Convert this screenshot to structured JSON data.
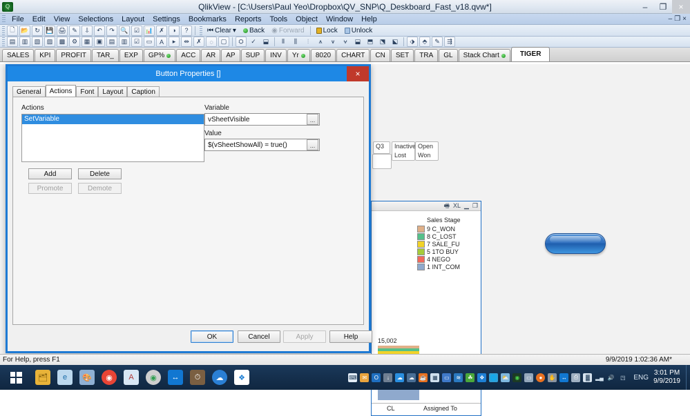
{
  "window": {
    "title": "QlikView - [C:\\Users\\Paul Yeo\\Dropbox\\QV_SNP\\Q_Deskboard_Fast_v18.qvw*]",
    "app_icon": "qlikview-icon",
    "minimize": "–",
    "restore": "❐",
    "close": "×"
  },
  "menubar": {
    "items": [
      {
        "label": "File"
      },
      {
        "label": "Edit"
      },
      {
        "label": "View"
      },
      {
        "label": "Selections"
      },
      {
        "label": "Layout"
      },
      {
        "label": "Settings"
      },
      {
        "label": "Bookmarks"
      },
      {
        "label": "Reports"
      },
      {
        "label": "Tools"
      },
      {
        "label": "Object"
      },
      {
        "label": "Window"
      },
      {
        "label": "Help"
      }
    ],
    "doc_controls": [
      "–",
      "❐",
      "×"
    ]
  },
  "toolbar": {
    "clear": "Clear",
    "clear_caret": "▾",
    "back": "Back",
    "forward": "Forward",
    "lock": "Lock",
    "unlock": "Unlock"
  },
  "sheet_tabs": [
    {
      "label": "SALES",
      "dot": false,
      "active": false
    },
    {
      "label": "KPI",
      "dot": false,
      "active": false
    },
    {
      "label": "PROFIT",
      "dot": false,
      "active": false
    },
    {
      "label": "TAR_",
      "dot": false,
      "active": false
    },
    {
      "label": "EXP",
      "dot": false,
      "active": false
    },
    {
      "label": "GP%",
      "dot": true,
      "active": false
    },
    {
      "label": "ACC",
      "dot": false,
      "active": false
    },
    {
      "label": "AR",
      "dot": false,
      "active": false
    },
    {
      "label": "AP",
      "dot": false,
      "active": false
    },
    {
      "label": "SUP",
      "dot": false,
      "active": false
    },
    {
      "label": "INV",
      "dot": false,
      "active": false
    },
    {
      "label": "Yr",
      "dot": true,
      "active": false
    },
    {
      "label": "8020",
      "dot": false,
      "active": false
    },
    {
      "label": "CHART",
      "dot": false,
      "active": false
    },
    {
      "label": "CN",
      "dot": false,
      "active": false
    },
    {
      "label": "SET",
      "dot": false,
      "active": false
    },
    {
      "label": "TRA",
      "dot": false,
      "active": false
    },
    {
      "label": "GL",
      "dot": false,
      "active": false
    },
    {
      "label": "Stack Chart",
      "dot": true,
      "active": false
    },
    {
      "label": "TIGER",
      "dot": false,
      "active": true
    }
  ],
  "dialog": {
    "title": "Button Properties []",
    "close": "×",
    "tabs": [
      {
        "label": "General",
        "active": false
      },
      {
        "label": "Actions",
        "active": true
      },
      {
        "label": "Font",
        "active": false
      },
      {
        "label": "Layout",
        "active": false
      },
      {
        "label": "Caption",
        "active": false
      }
    ],
    "actions_label": "Actions",
    "actions_items": [
      "SetVariable"
    ],
    "variable_label": "Variable",
    "variable_value": "vSheetVisible",
    "value_label": "Value",
    "value_value": "$(vSheetShowAll) = true()",
    "ellipsis": "...",
    "buttons": {
      "add": "Add",
      "delete": "Delete",
      "promote": "Promote",
      "demote": "Demote"
    },
    "footer": {
      "ok": "OK",
      "cancel": "Cancel",
      "apply": "Apply",
      "help": "Help"
    }
  },
  "listboxes": [
    {
      "name": "q3",
      "cells": [
        "Q3"
      ]
    },
    {
      "name": "status",
      "cells": [
        "Inactive",
        "Lost"
      ]
    },
    {
      "name": "outcome",
      "cells": [
        "Open",
        "Won"
      ]
    }
  ],
  "chart_panel": {
    "caption_icons": [
      "print-icon",
      "XL",
      "–",
      "❐"
    ],
    "xl_label": "XL"
  },
  "chart_data": {
    "type": "bar",
    "title": "",
    "legend_title": "Sales Stage",
    "legend_position": "top-right",
    "stacked": true,
    "categories": [
      "CL"
    ],
    "xlabel": "Assigned To",
    "ylabel": "",
    "total_label": "15,002",
    "total_value": 15002,
    "series": [
      {
        "name": "9 C_WON",
        "color": "#e0b088",
        "values": [
          500
        ]
      },
      {
        "name": "8 C_LOST",
        "color": "#55c08a",
        "values": [
          420
        ]
      },
      {
        "name": "7 SALE_FU",
        "color": "#f2d329",
        "values": [
          1150
        ]
      },
      {
        "name": "5 1TO BUY",
        "color": "#a6cc3a",
        "values": [
          480
        ]
      },
      {
        "name": "4 NEGO",
        "color": "#f2695c",
        "values": [
          900
        ]
      },
      {
        "name": "1 INT_COM",
        "color": "#8fa9cd",
        "values": [
          11552
        ]
      }
    ]
  },
  "statusbar": {
    "help_text": "For Help, press F1",
    "timestamp": "9/9/2019 1:02:36 AM*"
  },
  "taskbar": {
    "start": "start-button",
    "pinned": [
      {
        "name": "file-explorer-icon",
        "glyph": "🗂",
        "color": "#e8b339"
      },
      {
        "name": "internet-explorer-icon",
        "glyph": "e",
        "color": "#1b9ad6"
      },
      {
        "name": "paint-icon",
        "glyph": "🎨",
        "color": "#6c8fc0"
      },
      {
        "name": "chrome-icon",
        "glyph": "◉",
        "color": "#e84435"
      },
      {
        "name": "document-icon",
        "glyph": "A",
        "color": "#cfe0f2"
      },
      {
        "name": "qlikview-icon",
        "glyph": "◉",
        "color": "#2f9e4f"
      },
      {
        "name": "teamviewer-icon",
        "glyph": "↔",
        "color": "#1177d1"
      },
      {
        "name": "clock-app-icon",
        "glyph": "⏱",
        "color": "#8a6a4a"
      },
      {
        "name": "onedrive-icon",
        "glyph": "☁",
        "color": "#1e7fd4"
      },
      {
        "name": "dropbox-icon",
        "glyph": "❖",
        "color": "#1e7fd4"
      }
    ],
    "tray": [
      {
        "name": "keyboard-icon",
        "glyph": "⌨",
        "color": "#d8e4f0"
      },
      {
        "name": "mail-icon",
        "glyph": "✉",
        "color": "#e8a33d"
      },
      {
        "name": "outlook-icon",
        "glyph": "O",
        "color": "#1f6fc0"
      },
      {
        "name": "updates-icon",
        "glyph": "↓",
        "color": "#6f7f92"
      },
      {
        "name": "onedrive-tray-icon",
        "glyph": "☁",
        "color": "#2a8fe0"
      },
      {
        "name": "cloud-error-icon",
        "glyph": "☁",
        "color": "#4a6f96"
      },
      {
        "name": "java-icon",
        "glyph": "☕",
        "color": "#e8701f"
      },
      {
        "name": "network-icon",
        "glyph": "▦",
        "color": "#cfe0ee"
      },
      {
        "name": "display-icon",
        "glyph": "▭",
        "color": "#3f79c8"
      },
      {
        "name": "fish-icon",
        "glyph": "≋",
        "color": "#2a79c0"
      },
      {
        "name": "clover-icon",
        "glyph": "☘",
        "color": "#4aa83a"
      },
      {
        "name": "dropbox-tray-icon",
        "glyph": "❖",
        "color": "#1e7fd4"
      },
      {
        "name": "globe-icon",
        "glyph": "🌐",
        "color": "#2fa0d8"
      },
      {
        "name": "weather-icon",
        "glyph": "⛅",
        "color": "#7fb8de"
      },
      {
        "name": "qlik-tray-icon",
        "glyph": "◉",
        "color": "#2f9e4f"
      },
      {
        "name": "monitor-icon",
        "glyph": "▭",
        "color": "#93a7bb"
      },
      {
        "name": "orange-circle-icon",
        "glyph": "●",
        "color": "#e8701f"
      },
      {
        "name": "hand-icon",
        "glyph": "✋",
        "color": "#8a94a0"
      },
      {
        "name": "teamviewer-tray-icon",
        "glyph": "↔",
        "color": "#1177d1"
      },
      {
        "name": "printer-error-icon",
        "glyph": "⎙",
        "color": "#9fb0c2"
      },
      {
        "name": "battery-icon",
        "glyph": "▓",
        "color": "#d5e2ee"
      },
      {
        "name": "signal-icon",
        "glyph": "■",
        "color": "#cfe0ee"
      },
      {
        "name": "volume-icon",
        "glyph": "🔊",
        "color": "#dbe8f4"
      },
      {
        "name": "action-center-icon",
        "glyph": "◱",
        "color": "#cfe0ee"
      }
    ],
    "language": "ENG",
    "time": "3:01 PM",
    "date": "9/9/2019"
  }
}
